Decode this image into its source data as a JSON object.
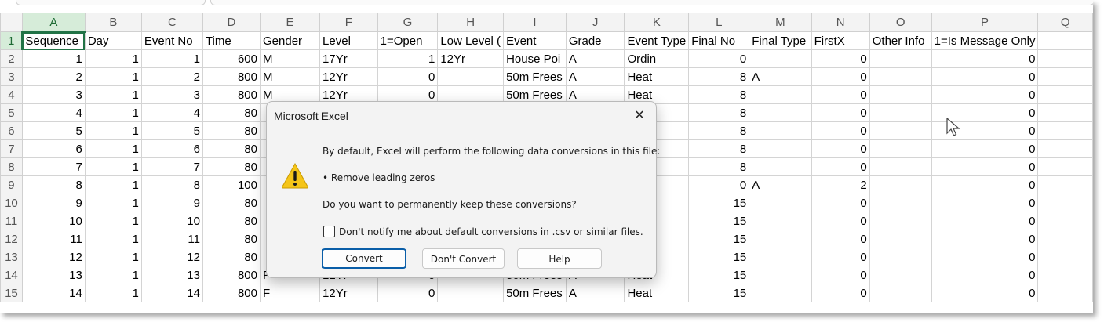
{
  "columns": [
    "A",
    "B",
    "C",
    "D",
    "E",
    "F",
    "G",
    "H",
    "I",
    "J",
    "K",
    "L",
    "M",
    "N",
    "O",
    "P",
    "Q"
  ],
  "active_cell": "A1",
  "header_row": [
    "Sequence",
    "Day",
    "Event No",
    "Time",
    "Gender",
    "Level",
    "1=Open",
    "Low Level (",
    "Event",
    "Grade",
    "Event Type",
    "Final No",
    "Final Type",
    "FirstX",
    "Other Info",
    "1=Is Message Only",
    ""
  ],
  "rows": [
    {
      "n": "2",
      "c": [
        "1",
        "1",
        "1",
        "600",
        "M",
        "17Yr",
        "1",
        "12Yr",
        "House Poi",
        "A",
        "Ordin",
        "0",
        "",
        "0",
        "",
        "0",
        ""
      ]
    },
    {
      "n": "3",
      "c": [
        "2",
        "1",
        "2",
        "800",
        "M",
        "12Yr",
        "0",
        "",
        "50m Frees",
        "A",
        "Heat",
        "8",
        "A",
        "0",
        "",
        "0",
        ""
      ]
    },
    {
      "n": "4",
      "c": [
        "3",
        "1",
        "3",
        "800",
        "M",
        "12Yr",
        "0",
        "",
        "50m Frees",
        "A",
        "Heat",
        "8",
        "",
        "0",
        "",
        "0",
        ""
      ]
    },
    {
      "n": "5",
      "c": [
        "4",
        "1",
        "4",
        "80",
        "",
        "",
        "",
        "",
        "",
        "",
        "Heat",
        "8",
        "",
        "0",
        "",
        "0",
        ""
      ]
    },
    {
      "n": "6",
      "c": [
        "5",
        "1",
        "5",
        "80",
        "",
        "",
        "",
        "",
        "",
        "",
        "Heat",
        "8",
        "",
        "0",
        "",
        "0",
        ""
      ]
    },
    {
      "n": "7",
      "c": [
        "6",
        "1",
        "6",
        "80",
        "",
        "",
        "",
        "",
        "",
        "",
        "Heat",
        "8",
        "",
        "0",
        "",
        "0",
        ""
      ]
    },
    {
      "n": "8",
      "c": [
        "7",
        "1",
        "7",
        "80",
        "",
        "",
        "",
        "",
        "",
        "",
        "Heat",
        "8",
        "",
        "0",
        "",
        "0",
        ""
      ]
    },
    {
      "n": "9",
      "c": [
        "8",
        "1",
        "8",
        "100",
        "",
        "",
        "",
        "",
        "",
        "",
        "Final",
        "0",
        "A",
        "2",
        "",
        "0",
        ""
      ]
    },
    {
      "n": "10",
      "c": [
        "9",
        "1",
        "9",
        "80",
        "",
        "",
        "",
        "",
        "",
        "",
        "Heat",
        "15",
        "",
        "0",
        "",
        "0",
        ""
      ]
    },
    {
      "n": "11",
      "c": [
        "10",
        "1",
        "10",
        "80",
        "",
        "",
        "",
        "",
        "",
        "",
        "Heat",
        "15",
        "",
        "0",
        "",
        "0",
        ""
      ]
    },
    {
      "n": "12",
      "c": [
        "11",
        "1",
        "11",
        "80",
        "",
        "",
        "",
        "",
        "",
        "",
        "Heat",
        "15",
        "",
        "0",
        "",
        "0",
        ""
      ]
    },
    {
      "n": "13",
      "c": [
        "12",
        "1",
        "12",
        "80",
        "",
        "",
        "",
        "",
        "",
        "",
        "Heat",
        "15",
        "",
        "0",
        "",
        "0",
        ""
      ]
    },
    {
      "n": "14",
      "c": [
        "13",
        "1",
        "13",
        "800",
        "F",
        "12Yr",
        "0",
        "",
        "50m Frees",
        "A",
        "Heat",
        "15",
        "",
        "0",
        "",
        "0",
        ""
      ]
    },
    {
      "n": "15",
      "c": [
        "14",
        "1",
        "14",
        "800",
        "F",
        "12Yr",
        "0",
        "",
        "50m Frees",
        "A",
        "Heat",
        "15",
        "",
        "0",
        "",
        "0",
        ""
      ]
    }
  ],
  "dialog": {
    "title": "Microsoft Excel",
    "close_glyph": "✕",
    "message": "By default, Excel will perform the following data conversions in this file:",
    "bullet": "• Remove leading zeros",
    "question": "Do you want to permanently keep these conversions?",
    "checkbox_label": "Don't notify me about default conversions in .csv or similar files.",
    "checkbox_checked": false,
    "buttons": {
      "convert": "Convert",
      "dont_convert": "Don't Convert",
      "help": "Help"
    },
    "icon": "warning-icon",
    "highlight_color": "#f2ec00"
  },
  "colors": {
    "accent": "#217346",
    "header_bg": "#f3f3f3",
    "warning": "#f5c518"
  }
}
